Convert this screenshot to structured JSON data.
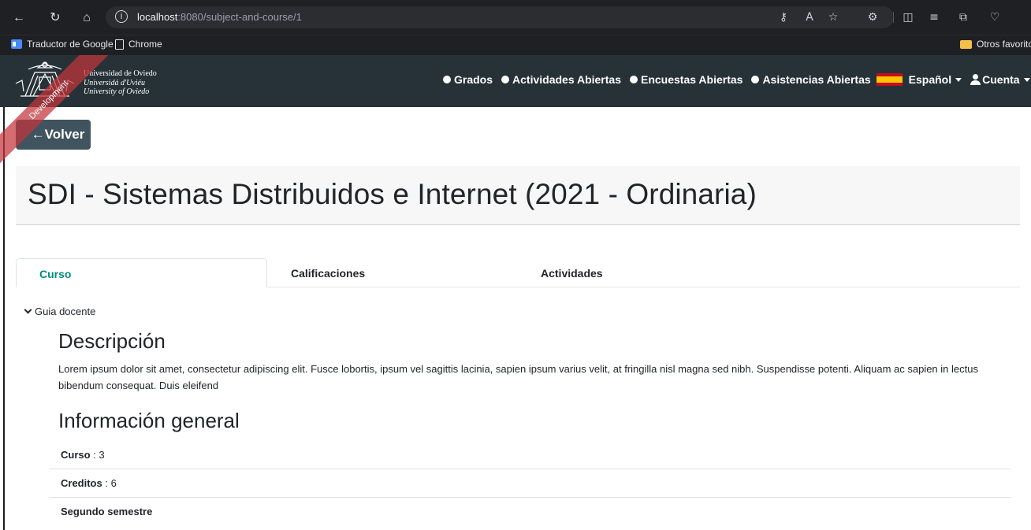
{
  "browser": {
    "url_host": "localhost",
    "url_path": ":8080/subject-and-course/1",
    "bookmarks": [
      "Traductor de Google",
      "Chrome"
    ],
    "other_bookmarks": "Otros favoritos"
  },
  "app": {
    "logo_lines": [
      "Universidad de Oviedo",
      "Universidá d'Uviéu",
      "University of Oviedo"
    ],
    "ribbon": "Development",
    "nav": {
      "grados": "Grados",
      "actividades": "Actividades Abiertas",
      "encuestas": "Encuestas Abiertas",
      "asistencias": "Asistencias Abiertas",
      "language": "Español",
      "account": "Cuenta"
    }
  },
  "page": {
    "back_label": "←Volver",
    "title": "SDI - Sistemas Distribuidos e Internet (2021 - Ordinaria)",
    "tabs": [
      "Curso",
      "Calificaciones",
      "Actividades"
    ],
    "guide_toggle": "Guia docente",
    "description_heading": "Descripción",
    "description_text": "Lorem ipsum dolor sit amet, consectetur adipiscing elit. Fusce lobortis, ipsum vel sagittis lacinia, sapien ipsum varius velit, at fringilla nisl magna sed nibh. Suspendisse potenti. Aliquam ac sapien in lectus bibendum consequat. Duis eleifend",
    "general_heading": "Información general",
    "info": [
      {
        "label": "Curso",
        "sep": " : ",
        "value": "3"
      },
      {
        "label": "Creditos",
        "sep": " : ",
        "value": "6"
      },
      {
        "label": "Segundo semestre",
        "sep": "",
        "value": ""
      }
    ]
  }
}
